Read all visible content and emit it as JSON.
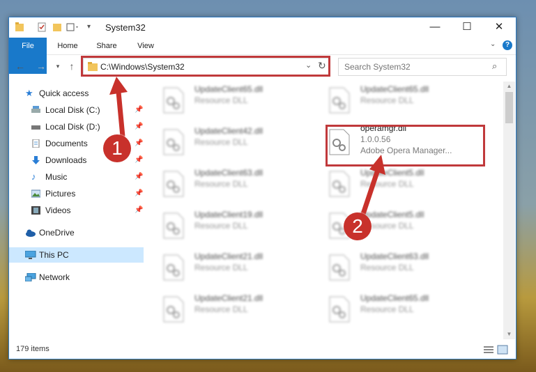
{
  "window": {
    "title": "System32",
    "minimize": "—",
    "maximize": "☐",
    "close": "✕"
  },
  "ribbon": {
    "file": "File",
    "home": "Home",
    "share": "Share",
    "view": "View"
  },
  "address": {
    "path": "C:\\Windows\\System32"
  },
  "search": {
    "placeholder": "Search System32"
  },
  "sidebar": {
    "quick_access": "Quick access",
    "items": [
      {
        "label": "Local Disk (C:)",
        "icon": "drive-icon"
      },
      {
        "label": "Local Disk (D:)",
        "icon": "drive-icon"
      },
      {
        "label": "Documents",
        "icon": "documents-icon"
      },
      {
        "label": "Downloads",
        "icon": "download-icon"
      },
      {
        "label": "Music",
        "icon": "music-icon"
      },
      {
        "label": "Pictures",
        "icon": "pictures-icon"
      },
      {
        "label": "Videos",
        "icon": "videos-icon"
      }
    ],
    "onedrive": "OneDrive",
    "this_pc": "This PC",
    "network": "Network"
  },
  "files": {
    "left": [
      {
        "name": "UpdateClient65.dll",
        "desc": "Resource DLL"
      },
      {
        "name": "UpdateClient42.dll",
        "desc": "Resource DLL"
      },
      {
        "name": "UpdateClient63.dll",
        "desc": "Resource DLL"
      },
      {
        "name": "UpdateClient19.dll",
        "desc": "Resource DLL"
      },
      {
        "name": "UpdateClient21.dll",
        "desc": "Resource DLL"
      },
      {
        "name": "UpdateClient21.dll",
        "desc": "Resource DLL"
      }
    ],
    "right": [
      {
        "name": "UpdateClient65.dll",
        "desc": "Resource DLL"
      },
      {
        "name": "UpdateClient5.dll",
        "desc": "Resource DLL"
      },
      {
        "name": "UpdateClient5.dll",
        "desc": "Resource DLL"
      },
      {
        "name": "UpdateClient63.dll",
        "desc": "Resource DLL"
      },
      {
        "name": "UpdateClient65.dll",
        "desc": "Resource DLL"
      }
    ],
    "highlighted": {
      "name": "operamgr.dll",
      "version": "1.0.0.56",
      "desc": "Adobe Opera Manager..."
    }
  },
  "status": {
    "count": "179 items"
  },
  "annotations": {
    "step1": "1",
    "step2": "2"
  },
  "colors": {
    "accent": "#1979ca",
    "callout": "#c8312b",
    "selected": "#cce8ff"
  }
}
